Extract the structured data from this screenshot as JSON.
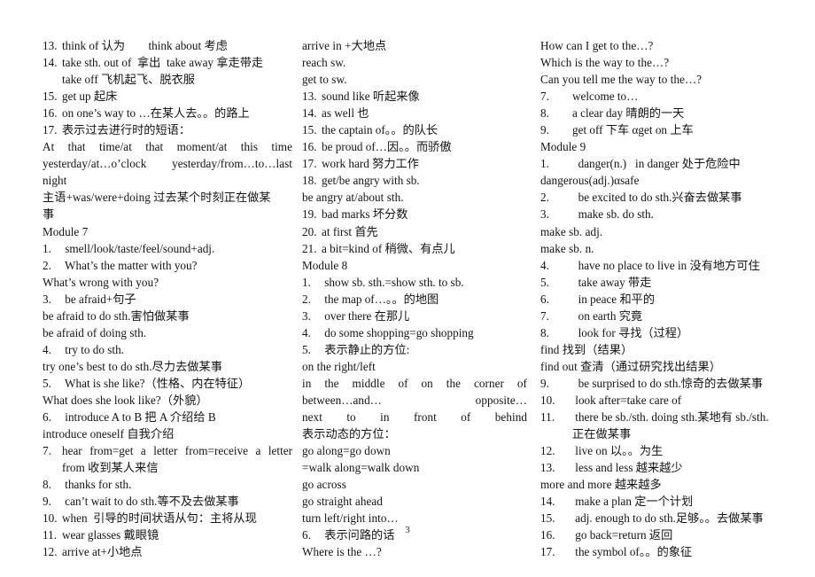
{
  "document": {
    "page_number": "3",
    "columns": [
      {
        "id": "column-1",
        "lines": [
          {
            "type": "numbered",
            "num": "13.",
            "text": "think of 认为        think about 考虑"
          },
          {
            "type": "numbered",
            "num": "14.",
            "text": "take sth. out of  拿出  take away 拿走带走"
          },
          {
            "type": "continuation",
            "text": "take off 飞机起飞、脱衣服"
          },
          {
            "type": "numbered",
            "num": "15.",
            "text": "get up 起床"
          },
          {
            "type": "numbered",
            "num": "16.",
            "text": "on one’s way to …在某人去。。的路上"
          },
          {
            "type": "numbered",
            "num": "17.",
            "text": "表示过去进行时的短语："
          },
          {
            "type": "justified",
            "text": "At that time/at that moment/at this time"
          },
          {
            "type": "justified",
            "text": "yesterday/at…o’clock yesterday/from…to…last"
          },
          {
            "type": "plain",
            "text": "night"
          },
          {
            "type": "plain",
            "text": "主语+was/were+doing 过去某个时刻正在做某"
          },
          {
            "type": "plain",
            "text": "事"
          },
          {
            "type": "plain",
            "text": "Module 7"
          },
          {
            "type": "numbered",
            "num": "1.",
            "text": " smell/look/taste/feel/sound+adj."
          },
          {
            "type": "numbered",
            "num": "2.",
            "text": " What’s the matter with you?"
          },
          {
            "type": "plain",
            "text": "What’s wrong with you?"
          },
          {
            "type": "numbered",
            "num": "3.",
            "text": " be afraid+句子"
          },
          {
            "type": "plain",
            "text": "be afraid to do sth.害怕做某事"
          },
          {
            "type": "plain",
            "text": "be afraid of doing sth."
          },
          {
            "type": "numbered",
            "num": "4.",
            "text": " try to do sth."
          },
          {
            "type": "plain",
            "text": "try one’s best to do sth.尽力去做某事"
          },
          {
            "type": "numbered",
            "num": "5.",
            "text": " What is she like?（性格、内在特征）"
          },
          {
            "type": "plain",
            "text": "What does she look like?（外貌）"
          },
          {
            "type": "numbered",
            "num": "6.",
            "text": " introduce A to B 把 A 介绍给 B"
          },
          {
            "type": "plain",
            "text": "introduce oneself 自我介绍"
          },
          {
            "type": "numbered-justified",
            "num": "7.",
            "text": "hear from=get a letter from=receive a letter"
          },
          {
            "type": "continuation",
            "text": "from 收到某人来信"
          },
          {
            "type": "numbered",
            "num": "8.",
            "text": " thanks for sth."
          },
          {
            "type": "numbered",
            "num": "9.",
            "text": " can’t wait to do sth.等不及去做某事"
          },
          {
            "type": "numbered",
            "num": "10.",
            "text": "when  引导的时间状语从句：主将从现"
          },
          {
            "type": "numbered",
            "num": "11.",
            "text": "wear glasses 戴眼镜"
          },
          {
            "type": "numbered",
            "num": "12.",
            "text": "arrive at+小地点"
          }
        ]
      },
      {
        "id": "column-2",
        "lines": [
          {
            "type": "plain",
            "text": "arrive in +大地点"
          },
          {
            "type": "plain",
            "text": "reach sw."
          },
          {
            "type": "plain",
            "text": "get to sw."
          },
          {
            "type": "numbered",
            "num": "13.",
            "text": "sound like 听起来像"
          },
          {
            "type": "numbered",
            "num": "14.",
            "text": "as well 也"
          },
          {
            "type": "numbered",
            "num": "15.",
            "text": "the captain of。。的队长"
          },
          {
            "type": "numbered",
            "num": "16.",
            "text": "be proud of…因。。而骄傲"
          },
          {
            "type": "numbered",
            "num": "17.",
            "text": "work hard 努力工作"
          },
          {
            "type": "numbered",
            "num": "18.",
            "text": "get/be angry with sb."
          },
          {
            "type": "plain",
            "text": "be angry at/about sth."
          },
          {
            "type": "numbered",
            "num": "19.",
            "text": "bad marks 坏分数"
          },
          {
            "type": "numbered",
            "num": "20.",
            "text": "at first 首先"
          },
          {
            "type": "numbered",
            "num": "21.",
            "text": "a bit=kind of 稍微、有点儿"
          },
          {
            "type": "plain",
            "text": "Module 8"
          },
          {
            "type": "numbered",
            "num": "1.",
            "text": " show sb. sth.=show sth. to sb."
          },
          {
            "type": "numbered",
            "num": "2.",
            "text": " the map of…。。的地图"
          },
          {
            "type": "numbered",
            "num": "3.",
            "text": " over there 在那儿"
          },
          {
            "type": "numbered",
            "num": "4.",
            "text": " do some shopping=go shopping"
          },
          {
            "type": "numbered",
            "num": "5.",
            "text": " 表示静止的方位:"
          },
          {
            "type": "plain",
            "text": "on the right/left"
          },
          {
            "type": "justified",
            "text": "in the middle of     on the corner of"
          },
          {
            "type": "justified",
            "text": "between…and…         opposite…"
          },
          {
            "type": "justified",
            "text": "next to          in front of        behind"
          },
          {
            "type": "plain",
            "text": "表示动态的方位："
          },
          {
            "type": "plain",
            "text": "go along=go down"
          },
          {
            "type": "plain",
            "text": "=walk along=walk down"
          },
          {
            "type": "plain",
            "text": "go across"
          },
          {
            "type": "plain",
            "text": "go straight ahead"
          },
          {
            "type": "plain",
            "text": "turn left/right into…"
          },
          {
            "type": "numbered",
            "num": "6.",
            "text": " 表示问路的话"
          },
          {
            "type": "plain",
            "text": "Where is the …?"
          }
        ]
      },
      {
        "id": "column-3",
        "lines": [
          {
            "type": "plain",
            "text": "How can I get to the…?"
          },
          {
            "type": "plain",
            "text": "Which is the way to the…?"
          },
          {
            "type": "plain",
            "text": "Can you tell me the way to the…?"
          },
          {
            "type": "numbered",
            "num": "7.",
            "text": "welcome to…"
          },
          {
            "type": "numbered",
            "num": "8.",
            "text": "a clear day 晴朗的一天"
          },
          {
            "type": "numbered",
            "num": "9.",
            "text": "get off 下车 αget on 上车"
          },
          {
            "type": "plain",
            "text": "Module 9"
          },
          {
            "type": "numbered",
            "num": "1.",
            "text": "  danger(n.)   in danger 处于危险中"
          },
          {
            "type": "plain",
            "text": "dangerous(adj.)αsafe"
          },
          {
            "type": "numbered",
            "num": "2.",
            "text": "  be excited to do sth.兴奋去做某事"
          },
          {
            "type": "numbered",
            "num": "3.",
            "text": "  make sb. do sth."
          },
          {
            "type": "plain",
            "text": "make sb. adj."
          },
          {
            "type": "plain",
            "text": "make sb. n."
          },
          {
            "type": "numbered",
            "num": "4.",
            "text": "  have no place to live in 没有地方可住"
          },
          {
            "type": "numbered",
            "num": "5.",
            "text": "  take away 带走"
          },
          {
            "type": "numbered",
            "num": "6.",
            "text": "  in peace 和平的"
          },
          {
            "type": "numbered",
            "num": "7.",
            "text": "  on earth 究竟"
          },
          {
            "type": "numbered",
            "num": "8.",
            "text": "  look for 寻找（过程）"
          },
          {
            "type": "plain",
            "text": "find 找到（结果）"
          },
          {
            "type": "plain",
            "text": "find out 查清（通过研究找出结果）"
          },
          {
            "type": "numbered",
            "num": "9.",
            "text": "  be surprised to do sth.惊奇的去做某事"
          },
          {
            "type": "numbered",
            "num": "10.",
            "text": " look after=take care of"
          },
          {
            "type": "numbered",
            "num": "11.",
            "text": " there be sb./sth. doing sth.某地有 sb./sth."
          },
          {
            "type": "continuation",
            "text": "正在做某事"
          },
          {
            "type": "numbered",
            "num": "12.",
            "text": " live on 以。。为生"
          },
          {
            "type": "numbered",
            "num": "13.",
            "text": " less and less 越来越少"
          },
          {
            "type": "plain",
            "text": "more and more 越来越多"
          },
          {
            "type": "numbered",
            "num": "14.",
            "text": " make a plan 定一个计划"
          },
          {
            "type": "numbered",
            "num": "15.",
            "text": " adj. enough to do sth.足够。。去做某事"
          },
          {
            "type": "numbered",
            "num": "16.",
            "text": " go back=return 返回"
          },
          {
            "type": "numbered",
            "num": "17.",
            "text": " the symbol of。。的象征"
          }
        ]
      }
    ]
  }
}
